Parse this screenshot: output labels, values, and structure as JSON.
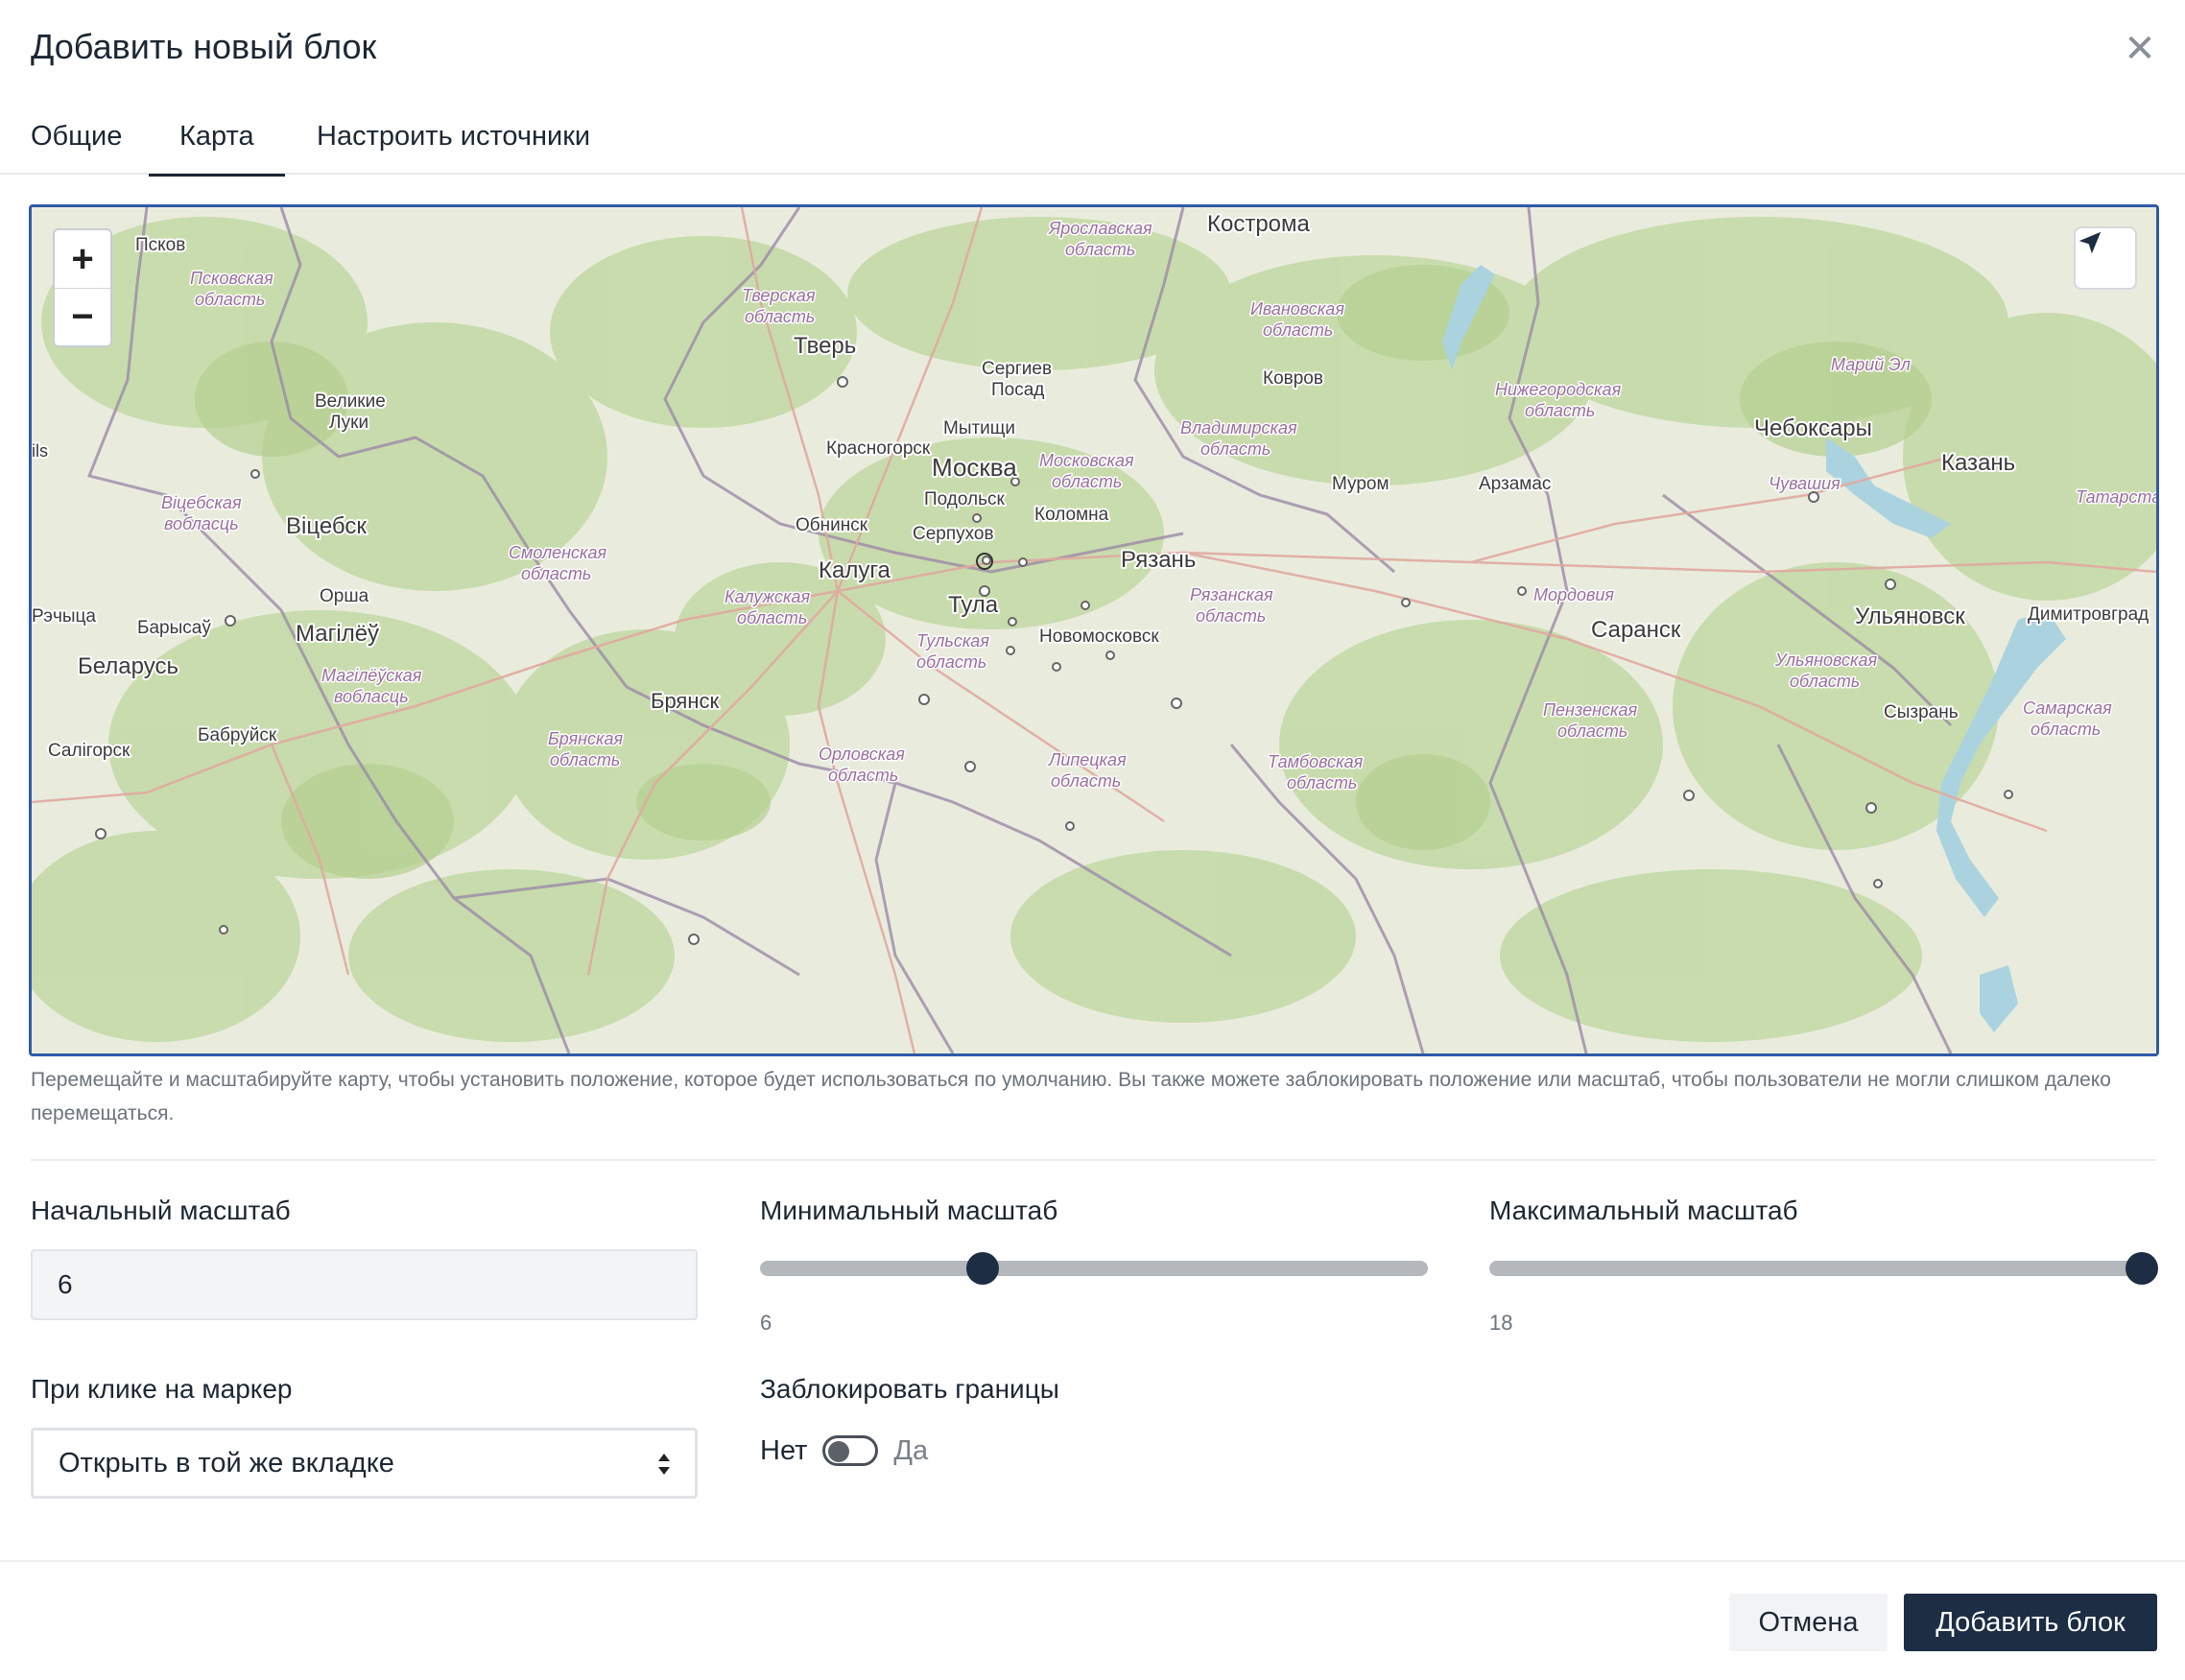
{
  "dialog": {
    "title": "Добавить новый блок",
    "close_icon": "close-icon"
  },
  "tabs": [
    {
      "label": "Общие",
      "active": false
    },
    {
      "label": "Карта",
      "active": true
    },
    {
      "label": "Настроить источники",
      "active": false
    }
  ],
  "map": {
    "zoom_in": "+",
    "zoom_out": "−",
    "locate_icon": "navigation-arrow-icon",
    "labels": {
      "pskov": "Псков",
      "pskov_obl_1": "Псковская",
      "pskov_obl_2": "область",
      "tver_obl_1": "Тверская",
      "tver_obl_2": "область",
      "yar_obl_1": "Ярославская",
      "yar_obl_2": "область",
      "kostroma": "Кострома",
      "ivanovo_obl_1": "Ивановская",
      "ivanovo_obl_2": "область",
      "tver": "Тверь",
      "sergiev_1": "Сергиев",
      "sergiev_2": "Посад",
      "kovrov": "Ковров",
      "mari_el": "Марий Эл",
      "nizh_obl_1": "Нижегородская",
      "nizh_obl_2": "область",
      "velikie_1": "Великие",
      "velikie_2": "Луки",
      "mytishchi": "Мытищи",
      "vlad_obl_1": "Владимирская",
      "vlad_obl_2": "область",
      "cheboksary": "Чебоксары",
      "kazan": "Казань",
      "krasnogorsk": "Красногорск",
      "moskva": "Москва",
      "mosk_obl_1": "Московская",
      "mosk_obl_2": "область",
      "murom": "Муром",
      "arzamas": "Арзамас",
      "chuvashia": "Чувашия",
      "tatarstan": "Татарстан",
      "podolsk": "Подольск",
      "viteb_obl_1": "Віцебская",
      "viteb_obl_2": "вобласць",
      "vitebsk": "Віцебск",
      "kolomna": "Коломна",
      "obninsk": "Обнинск",
      "serpukhov": "Серпухов",
      "smol_obl_1": "Смоленская",
      "smol_obl_2": "область",
      "ryazan": "Рязань",
      "kaluga": "Калуга",
      "orsha": "Орша",
      "ryaz_obl_1": "Рязанская",
      "ryaz_obl_2": "область",
      "kalug_obl_1": "Калужская",
      "kalug_obl_2": "область",
      "mordovia": "Мордовия",
      "tula": "Тула",
      "rechitsa": "Рэчыца",
      "barysau": "Барысаў",
      "mahilyou": "Магілёў",
      "saransk": "Саранск",
      "ulyanovsk": "Ульяновск",
      "dimitrovgrad": "Димитровград",
      "novomoskovsk": "Новомосковск",
      "tul_obl_1": "Тульская",
      "tul_obl_2": "область",
      "belarus": "Беларусь",
      "ulyan_obl_1": "Ульяновская",
      "ulyan_obl_2": "область",
      "mahil_obl_1": "Магілёўская",
      "mahil_obl_2": "вобласць",
      "bryansk": "Брянск",
      "penza_obl_1": "Пензенская",
      "penza_obl_2": "область",
      "samara_obl_1": "Самарская",
      "samara_obl_2": "область",
      "syzran": "Сызрань",
      "babruisk": "Бабруйск",
      "salihorsk": "Салігорск",
      "bryan_obl_1": "Брянская",
      "bryan_obl_2": "область",
      "orel_obl_1": "Орловская",
      "orel_obl_2": "область",
      "lip_obl_1": "Липецкая",
      "lip_obl_2": "область",
      "tamb_obl_1": "Тамбовская",
      "tamb_obl_2": "область",
      "vilnius_frag": "ils"
    }
  },
  "help_text": "Перемещайте и масштабируйте карту, чтобы установить положение, которое будет использоваться по умолчанию. Вы также можете заблокировать положение или масштаб, чтобы пользователи не могли слишком далеко перемещаться.",
  "initial_zoom": {
    "label": "Начальный масштаб",
    "value": "6"
  },
  "min_zoom": {
    "label": "Минимальный масштаб",
    "value": "6",
    "range": [
      0,
      18
    ],
    "level": 6
  },
  "max_zoom": {
    "label": "Максимальный масштаб",
    "value": "18",
    "range": [
      0,
      18
    ],
    "level": 18
  },
  "marker_click": {
    "label": "При клике на маркер",
    "selected": "Открыть в той же вкладке"
  },
  "lock_bounds": {
    "label": "Заблокировать границы",
    "off_label": "Нет",
    "on_label": "Да",
    "enabled": false
  },
  "footer": {
    "cancel_label": "Отмена",
    "add_label": "Добавить блок"
  },
  "colors": {
    "primary": "#1c2d44",
    "map_border": "#2f5aa8",
    "land": "#e9ecdd",
    "forest": "#c9dcae",
    "water": "#aad3df"
  }
}
